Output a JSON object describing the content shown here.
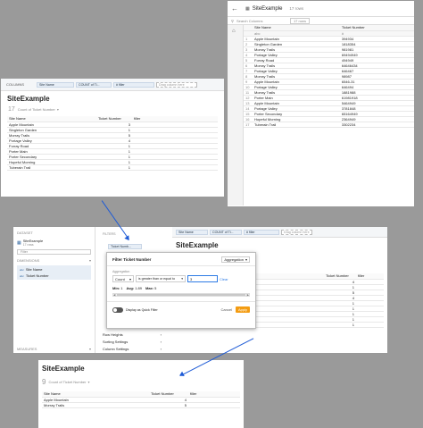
{
  "panel1": {
    "title": "SiteExample",
    "rows_count": "17 rows",
    "search_placeholder": "Search Columns",
    "rows_badge": "17 rows",
    "col_site": "Site Name",
    "col_ticket": "Ticket Number",
    "sub_abc": "abc",
    "sub_hash": "#",
    "rows": [
      {
        "n": "1",
        "site": "Apple Mountain",
        "ticket": "394934"
      },
      {
        "n": "2",
        "site": "Singleton Garden",
        "ticket": "1818354"
      },
      {
        "n": "3",
        "site": "Morray Trails",
        "ticket": "981981"
      },
      {
        "n": "4",
        "site": "Portage Valley",
        "ticket": "69494949"
      },
      {
        "n": "5",
        "site": "Forray Road",
        "ticket": "494949"
      },
      {
        "n": "6",
        "site": "Morray Trails",
        "ticket": "64646434"
      },
      {
        "n": "7",
        "site": "Portage Valley",
        "ticket": "646467"
      },
      {
        "n": "8",
        "site": "Morray Trails",
        "ticket": "98987"
      },
      {
        "n": "9",
        "site": "Apple Mountain",
        "ticket": "6546-31"
      },
      {
        "n": "10",
        "site": "Portage Valley",
        "ticket": "646494"
      },
      {
        "n": "11",
        "site": "Morray Trails",
        "ticket": "1881988"
      },
      {
        "n": "12",
        "site": "Porter Main",
        "ticket": "61981918"
      },
      {
        "n": "13",
        "site": "Apple Mountain",
        "ticket": "5464949"
      },
      {
        "n": "14",
        "site": "Portage Valley",
        "ticket": "3781848"
      },
      {
        "n": "15",
        "site": "Porter Secondary",
        "ticket": "65164949"
      },
      {
        "n": "16",
        "site": "Hopeful Morning",
        "ticket": "2364949"
      },
      {
        "n": "17",
        "site": "Tuberain Trail",
        "ticket": "3302234"
      }
    ]
  },
  "panel2": {
    "columns_label": "COLUMNS",
    "pills": [
      "Site Name",
      "COUNT of Ti...",
      "# filler"
    ],
    "drag_hint": "Drag column here",
    "title": "SiteExample",
    "count": "17",
    "count_label": "Count of Ticket Number",
    "col_site": "Site Name",
    "col_ticket": "Ticket Number",
    "col_filler": "filler",
    "rows": [
      {
        "site": "Apple Mountain",
        "val": "3"
      },
      {
        "site": "Singleton Garden",
        "val": "1"
      },
      {
        "site": "Morray Trails",
        "val": "5"
      },
      {
        "site": "Portage Valley",
        "val": "4"
      },
      {
        "site": "Forray Road",
        "val": "1"
      },
      {
        "site": "Porter Main",
        "val": "1"
      },
      {
        "site": "Porter Secondary",
        "val": "1"
      },
      {
        "site": "Hopeful Morning",
        "val": "1"
      },
      {
        "site": "Tuberain Trail",
        "val": "1"
      }
    ]
  },
  "panel3": {
    "dataset_label": "DATASET",
    "dataset_name": "SiteExample",
    "dataset_sub": "17 rows",
    "filter_placeholder": "Filter",
    "dimensions_label": "DIMENSIONS",
    "dims": [
      "Site Name",
      "Ticket Number"
    ],
    "measures_label": "MEASURES",
    "filters_label": "FILTERS",
    "filter_chip": "Ticket Numb...",
    "pills": [
      "Site Name",
      "COUNT of Ti...",
      "# filler"
    ],
    "drag_hint": "Drag column here",
    "title": "SiteExample",
    "col_site": "Site Name",
    "col_ticket": "Ticket Number",
    "col_filler": "filler",
    "values": [
      "4",
      "1",
      "5",
      "4",
      "1",
      "1",
      "1",
      "1",
      "1"
    ],
    "bottom_rows": [
      "Hopeful Morning",
      "Tuberain Trail"
    ],
    "options": [
      "Row Heights",
      "Sorting Settings",
      "Column Settings"
    ],
    "dialog": {
      "title": "Filter Ticket Number",
      "mode": "Aggregation",
      "agg_label": "Aggregation",
      "agg_value": "Count",
      "cond_value": "is greater than or equal to",
      "input_value": "3",
      "clear": "Clear",
      "min_label": "Min:",
      "min": "1",
      "avg_label": "Avg:",
      "avg": "1.89",
      "max_label": "Max:",
      "max": "5",
      "quick_filter": "Display as Quick Filter",
      "cancel": "Cancel",
      "apply": "Apply"
    }
  },
  "panel4": {
    "title": "SiteExample",
    "count": "9",
    "count_label": "Count of Ticket Number",
    "col_site": "Site Name",
    "col_ticket": "Ticket Number",
    "col_filler": "filler",
    "rows": [
      {
        "site": "Apple Mountain",
        "val": "4"
      },
      {
        "site": "Morray Trails",
        "val": "5"
      }
    ]
  },
  "colors": {
    "accent": "#f39c12",
    "arrow": "#1e5bd6",
    "pill": "#e7eef6"
  }
}
